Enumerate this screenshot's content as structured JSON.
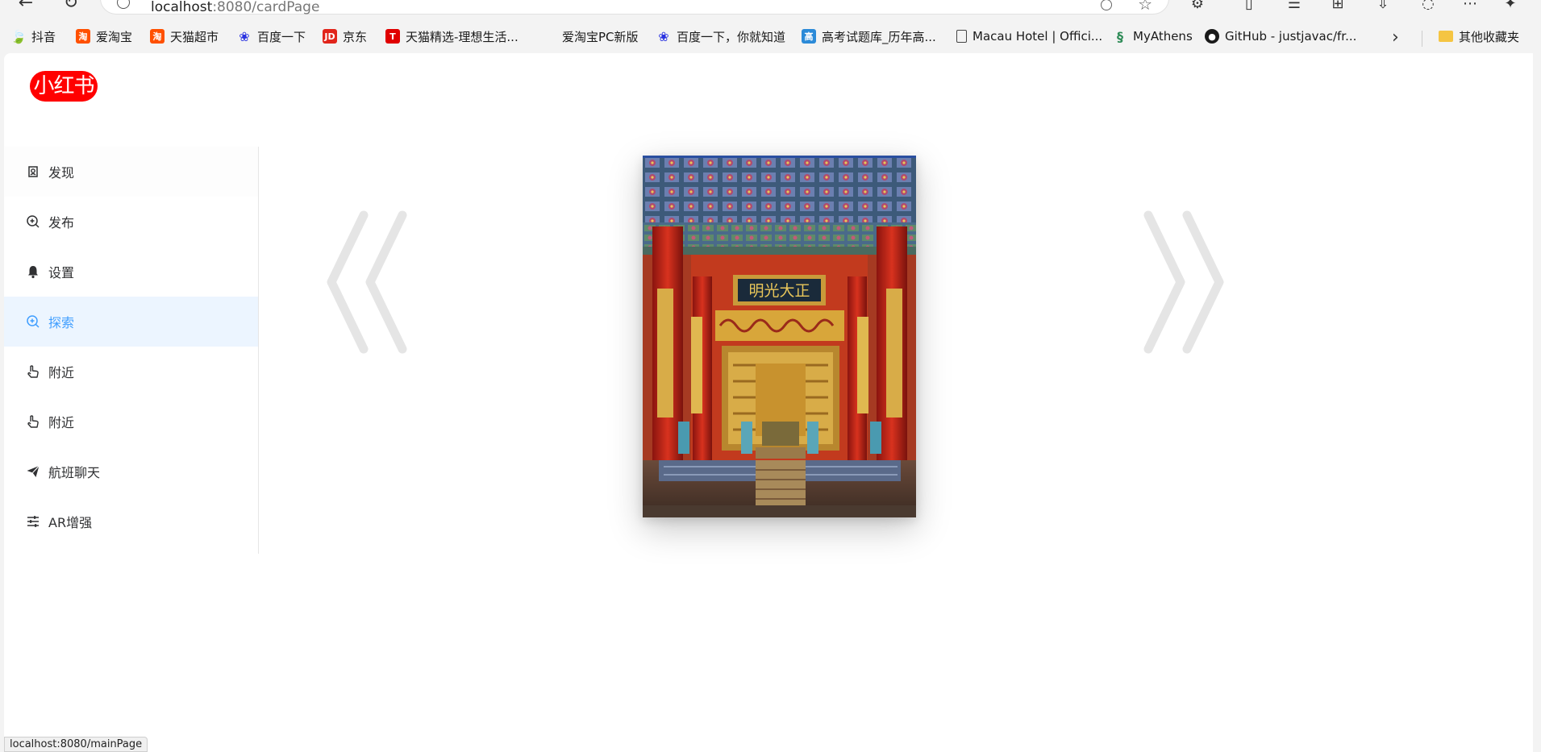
{
  "browser": {
    "url_host": "localhost",
    "url_path": ":8080/cardPage",
    "bookmarks": [
      {
        "label": "抖音",
        "icon": "douyin-icon",
        "color": "#7cb342"
      },
      {
        "label": "爱淘宝",
        "icon": "taobao-icon",
        "color": "#ff5000"
      },
      {
        "label": "天猫超市",
        "icon": "taobao-icon",
        "color": "#ff5000"
      },
      {
        "label": "百度一下",
        "icon": "baidu-paw-icon",
        "color": "#2932e1"
      },
      {
        "label": "京东",
        "icon": "jd-icon",
        "color": "#e1251b"
      },
      {
        "label": "天猫精选-理想生活...",
        "icon": "tmall-icon",
        "color": "#e00000"
      },
      {
        "label": "爱淘宝PC新版",
        "icon": "",
        "color": ""
      },
      {
        "label": "百度一下，你就知道",
        "icon": "baidu-paw-icon",
        "color": "#2932e1"
      },
      {
        "label": "高考试题库_历年高...",
        "icon": "gaokao-icon",
        "color": "#2b8ad8"
      },
      {
        "label": "Macau Hotel | Offici...",
        "icon": "page-icon",
        "color": "#444444"
      },
      {
        "label": "MyAthens",
        "icon": "myathens-icon",
        "color": "#2e8b57"
      },
      {
        "label": "GitHub - justjavac/fr...",
        "icon": "github-icon",
        "color": "#1a1a1a"
      }
    ],
    "other_bookmarks": "其他收藏夹",
    "status_url": "localhost:8080/mainPage"
  },
  "app": {
    "logo": "小红书",
    "menu": [
      {
        "label": "发现",
        "icon": "discover-icon"
      },
      {
        "label": "发布",
        "icon": "zoom-in-icon"
      },
      {
        "label": "设置",
        "icon": "bell-icon"
      },
      {
        "label": "探索",
        "icon": "zoom-in-icon",
        "active": true
      },
      {
        "label": "附近",
        "icon": "pointer-hand-icon"
      },
      {
        "label": "附近",
        "icon": "pointer-hand-icon"
      },
      {
        "label": "航班聊天",
        "icon": "paper-plane-icon"
      },
      {
        "label": "AR增强",
        "icon": "sliders-icon"
      }
    ]
  },
  "colors": {
    "logo_bg": "#ff0000",
    "active_text": "#409eff",
    "active_bg": "#ecf5ff",
    "arrow": "#e5e5e5"
  }
}
